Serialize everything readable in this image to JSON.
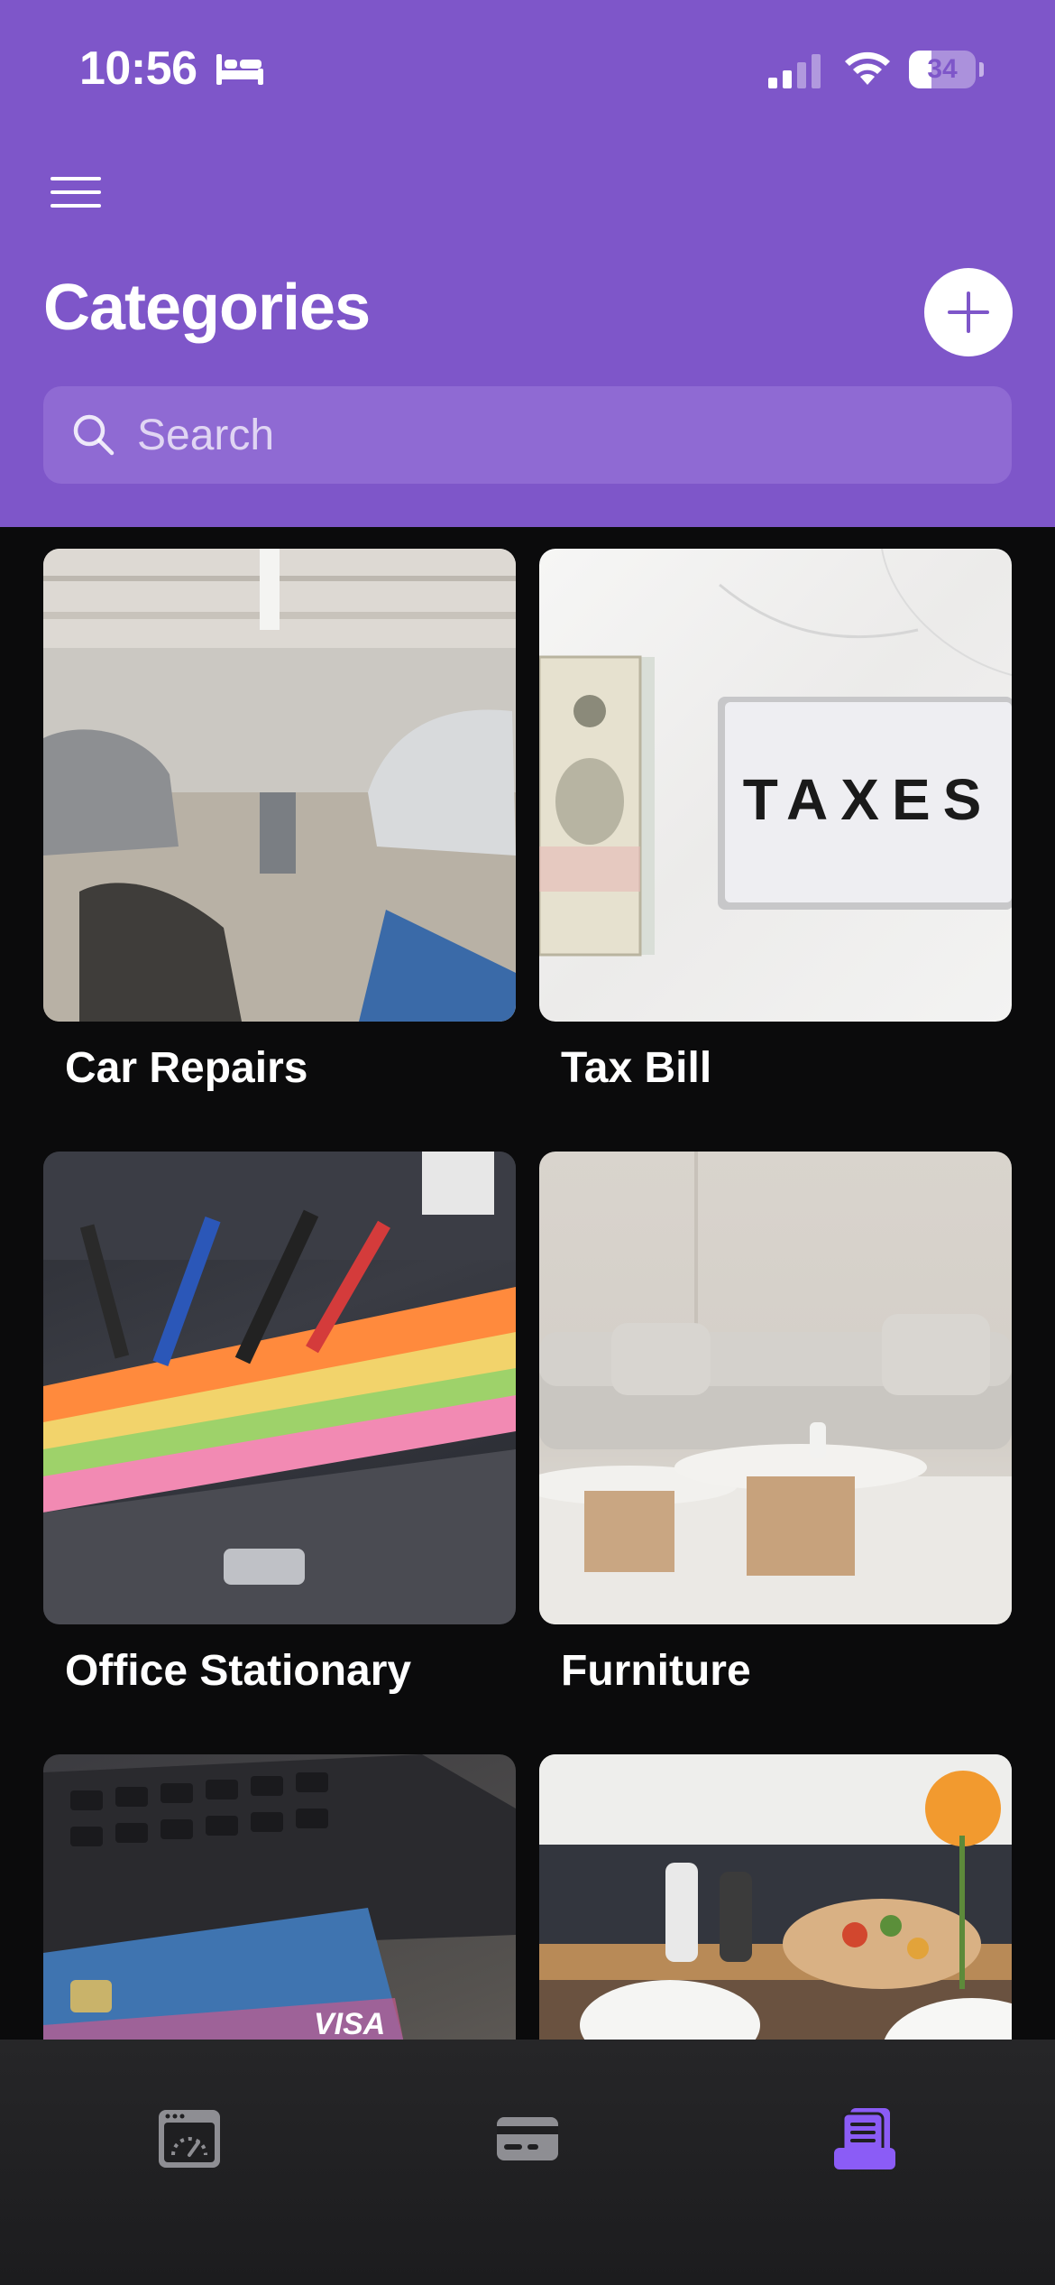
{
  "status_bar": {
    "time": "10:56",
    "battery_percent": "34",
    "battery_level": 0.34,
    "bed_icon": "bed-icon",
    "signal_icon": "cellular-signal-icon",
    "wifi_icon": "wifi-icon"
  },
  "header": {
    "menu_icon": "hamburger-menu-icon",
    "title": "Categories",
    "add_icon": "plus-icon",
    "background_color": "#7e56c9"
  },
  "search": {
    "placeholder": "Search",
    "value": "",
    "icon": "search-icon"
  },
  "categories": [
    {
      "label": "Car Repairs",
      "image": "car-garage-photo"
    },
    {
      "label": "Tax Bill",
      "image": "taxes-lightbox-and-cash-photo"
    },
    {
      "label": "Office Stationary",
      "image": "pens-and-sticky-notes-photo"
    },
    {
      "label": "Furniture",
      "image": "sofa-and-coffee-tables-photo"
    },
    {
      "label": "",
      "image": "credit-card-on-laptop-photo"
    },
    {
      "label": "",
      "image": "food-table-photo"
    }
  ],
  "tab_bar": {
    "tabs": [
      {
        "icon": "dashboard-gauge-icon",
        "active": false
      },
      {
        "icon": "credit-card-icon",
        "active": false
      },
      {
        "icon": "categories-list-icon",
        "active": true
      }
    ],
    "active_color": "#8b5cf6",
    "inactive_color": "#8e8e93"
  }
}
